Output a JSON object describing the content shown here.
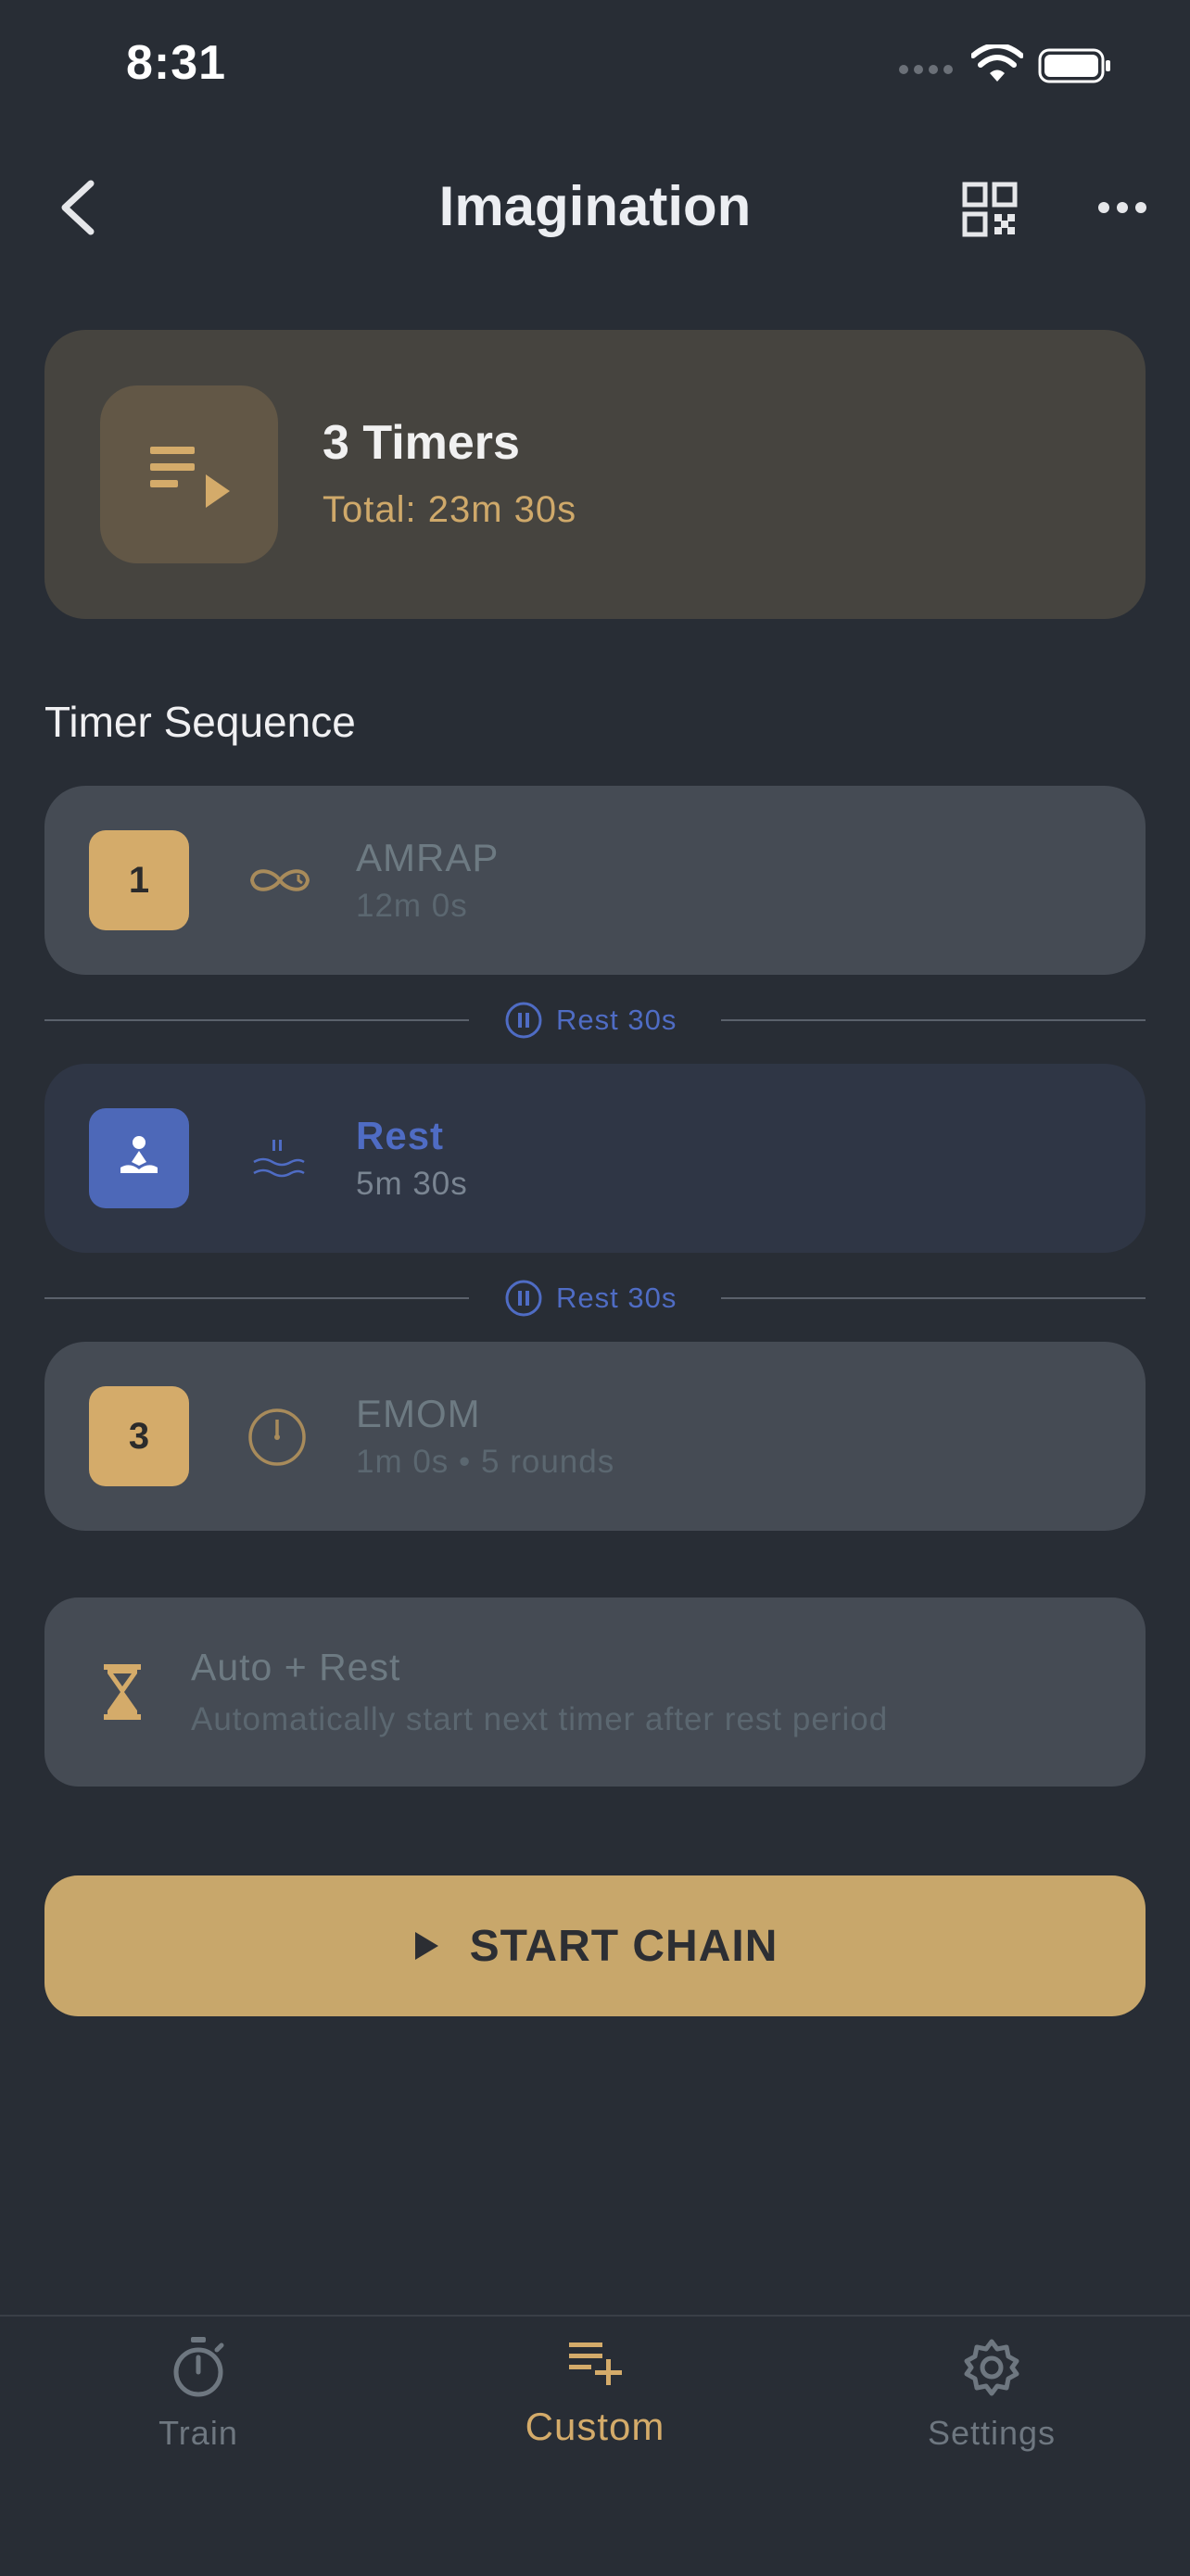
{
  "status_bar": {
    "time": "8:31"
  },
  "header": {
    "title": "Imagination"
  },
  "summary": {
    "count_label": "3 Timers",
    "total_label": "Total: 23m 30s"
  },
  "section_title": "Timer Sequence",
  "timers": [
    {
      "badge": "1",
      "name": "AMRAP",
      "detail": "12m 0s",
      "icon": "infinity-icon"
    },
    {
      "badge": "",
      "name": "Rest",
      "detail": "5m 30s",
      "icon": "meditation-icon"
    },
    {
      "badge": "3",
      "name": "EMOM",
      "detail": "1m 0s • 5 rounds",
      "icon": "clock-icon"
    }
  ],
  "rest_separators": [
    "Rest 30s",
    "Rest 30s"
  ],
  "auto_rest": {
    "title": "Auto + Rest",
    "subtitle": "Automatically start next timer after rest period"
  },
  "start_button": {
    "label": "START CHAIN"
  },
  "tabs": [
    {
      "label": "Train",
      "icon": "stopwatch-icon",
      "active": false
    },
    {
      "label": "Custom",
      "icon": "playlist-add-icon",
      "active": true
    },
    {
      "label": "Settings",
      "icon": "gear-icon",
      "active": false
    }
  ],
  "colors": {
    "background": "#282d35",
    "accent": "#d4ab6a",
    "rest_blue": "#4f6cc4",
    "card": "#454b54"
  }
}
